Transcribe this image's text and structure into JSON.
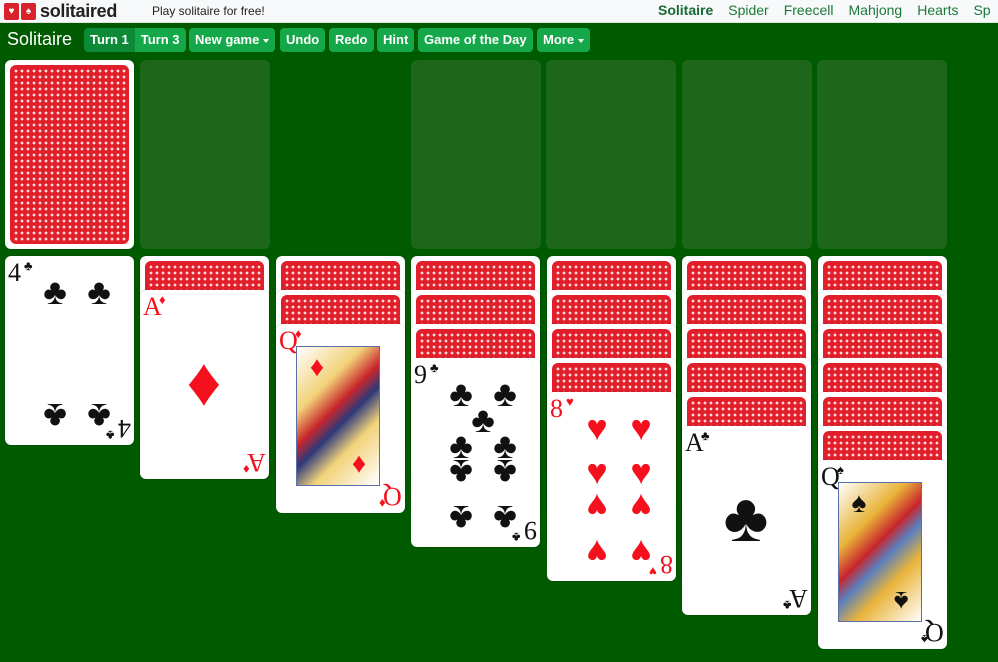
{
  "header": {
    "logo_text": "solitaired",
    "tagline": "Play solitaire for free!",
    "nav": [
      "Solitaire",
      "Spider",
      "Freecell",
      "Mahjong",
      "Hearts",
      "Sp"
    ],
    "active_nav": "Solitaire"
  },
  "toolbar": {
    "title": "Solitaire",
    "turn1": "Turn 1",
    "turn3": "Turn 3",
    "new_game": "New game",
    "undo": "Undo",
    "redo": "Redo",
    "hint": "Hint",
    "game_of_the_day": "Game of the Day",
    "more": "More"
  },
  "colors": {
    "felt": "#005a00",
    "slot": "#1e661a",
    "button": "#14a84a",
    "card_red": "#f4111d",
    "card_back": "#e01f2a"
  },
  "stock": {
    "face_down": true
  },
  "waste": {
    "empty": true
  },
  "foundations": [
    {
      "empty": true
    },
    {
      "empty": true
    },
    {
      "empty": true
    },
    {
      "empty": true
    }
  ],
  "tableau": [
    {
      "hidden": 0,
      "top": {
        "rank": "4",
        "suit": "♣",
        "color": "black"
      }
    },
    {
      "hidden": 1,
      "top": {
        "rank": "A",
        "suit": "♦",
        "color": "red"
      }
    },
    {
      "hidden": 2,
      "top": {
        "rank": "Q",
        "suit": "♦",
        "color": "red"
      }
    },
    {
      "hidden": 3,
      "top": {
        "rank": "9",
        "suit": "♣",
        "color": "black"
      }
    },
    {
      "hidden": 4,
      "top": {
        "rank": "8",
        "suit": "♥",
        "color": "red"
      }
    },
    {
      "hidden": 5,
      "top": {
        "rank": "A",
        "suit": "♣",
        "color": "black"
      }
    },
    {
      "hidden": 6,
      "top": {
        "rank": "Q",
        "suit": "♠",
        "color": "black"
      }
    }
  ]
}
